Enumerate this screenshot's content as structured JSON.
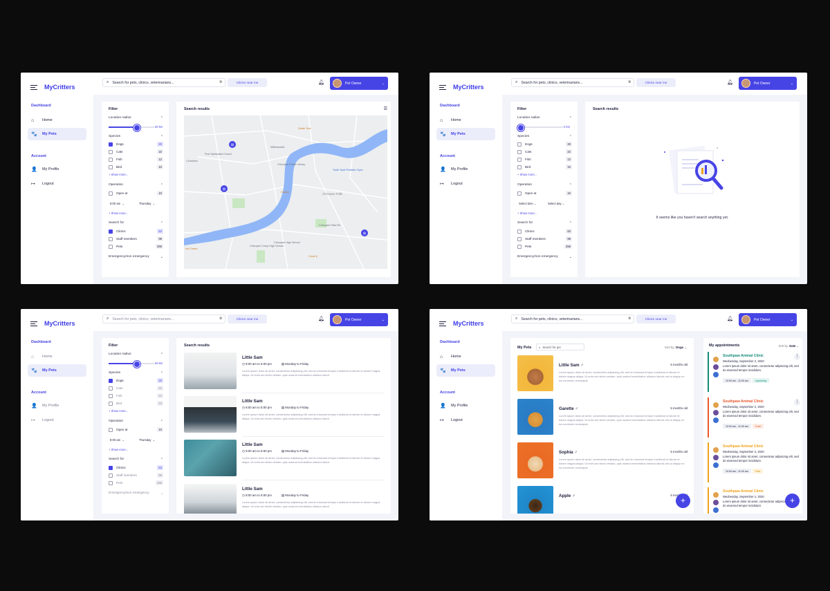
{
  "app": {
    "brand": "MyCritters",
    "sections": {
      "dashboard": "Dashboard",
      "account": "Account"
    },
    "nav": {
      "home": "Home",
      "my_pets": "My Pets",
      "my_profile": "My Profile",
      "logout": "Logout"
    }
  },
  "header": {
    "search_placeholder": "Search for pets, clinics, veterinarians...",
    "near_me": "Clinics near me",
    "user": "Pet Owner"
  },
  "filter": {
    "title": "Filter",
    "location_radius": "Location radius",
    "radius_value": "50 km",
    "radius_value_empty": "0 km",
    "species_title": "Species",
    "species": [
      {
        "label": "Dogs",
        "count": "20"
      },
      {
        "label": "Cats",
        "count": "22"
      },
      {
        "label": "Fish",
        "count": "12"
      },
      {
        "label": "Bird",
        "count": "10"
      }
    ],
    "show_more": "+ Show more...",
    "operation_title": "Operation",
    "open_at": "Open at",
    "open_count": "10",
    "time": "8:00 am",
    "day": "Thursday",
    "select_time": "Select time",
    "select_day": "Select day",
    "search_for_title": "Search for",
    "search_for": [
      {
        "label": "Clinics",
        "count": "53"
      },
      {
        "label": "Staff members",
        "count": "99"
      },
      {
        "label": "Pets",
        "count": "256"
      }
    ],
    "emergency": "Emergency/non emergency"
  },
  "results": {
    "title": "Search results",
    "empty": "It seems like you haven't search anything yet.",
    "hours": "8:00 am to 5:00 pm",
    "days": "Monday to Friday",
    "lorem": "Lorem ipsum dolor sit amet, consectetur adipiscing elit, sed do eiusmod tempor incididunt ut labore et dolore magna aliqua. Ut enim ad minim veniam, quis nostrud exercitation ullamco labori",
    "items": [
      {
        "name": "Little Sam"
      },
      {
        "name": "Little Sam"
      },
      {
        "name": "Little Sam"
      },
      {
        "name": "Little Sam"
      }
    ]
  },
  "map": {
    "labels": [
      "First Spiritualist Church",
      "Willimansett",
      "Chicopee Falls",
      "Columbus",
      "Chicopee Public Library",
      "Dollar Tree",
      "Chicopee High School",
      "Tooth Spot Pediatric Spec",
      "Costco",
      "Chicopee Falls Rd",
      "Ice Cream",
      "Chicopee Comp High School",
      "Circle K"
    ]
  },
  "my_pets": {
    "title": "My Pets",
    "search_placeholder": "Search for pet",
    "sort_label": "Sort by",
    "sort_value": "Dogs",
    "lorem": "Lorem ipsum dolor sit amet, consectetur adipiscing elit, sed do eiusmod tempor incididunt ut labore et dolore magna aliqua. Ut enim ad minim veniam, quis nostrud exercitation ullamco laboris nisi ut aliquip ex ea commodo consequat.",
    "pets": [
      {
        "name": "Little Sam",
        "gender": "♂",
        "age": "5 months old"
      },
      {
        "name": "Garette",
        "gender": "♂",
        "age": "5 months old"
      },
      {
        "name": "Sophia",
        "gender": "♂",
        "age": "5 months old"
      },
      {
        "name": "Apple",
        "gender": "♂",
        "age": "5 months old"
      }
    ]
  },
  "appointments": {
    "title": "My appointments",
    "sort_label": "Sort by",
    "sort_value": "Date",
    "desc": "Lorem ipsum dolor sit amet, consectetur adipiscing elit, sed do eiusmod tempor incididunt.",
    "time": "10:00 am - 11:00 am",
    "items": [
      {
        "clinic": "Southpaw Animal Clinic",
        "date": "Wednesday, September 2, 2020",
        "status": "Upcoming",
        "color": "#14897a",
        "status_bg": "#e2f4f0"
      },
      {
        "clinic": "Southpaw Animal Clinic",
        "date": "Wednesday, September 2, 2020",
        "status": "Draft",
        "color": "#e9562c",
        "status_bg": "#fdece4"
      },
      {
        "clinic": "Southpaw Animal Clinic",
        "date": "Wednesday, September 2, 2020",
        "status": "Past",
        "color": "#f0a21a",
        "status_bg": "#fdf3dc"
      },
      {
        "clinic": "Southpaw Animal Clinic",
        "date": "Wednesday, September 2, 2020",
        "status": "",
        "color": "#f0a21a",
        "status_bg": "#fdf3dc"
      }
    ]
  },
  "colors": {
    "accent": "#4744e6",
    "background": "#0c0c0d",
    "panel": "#f3f4f9"
  }
}
